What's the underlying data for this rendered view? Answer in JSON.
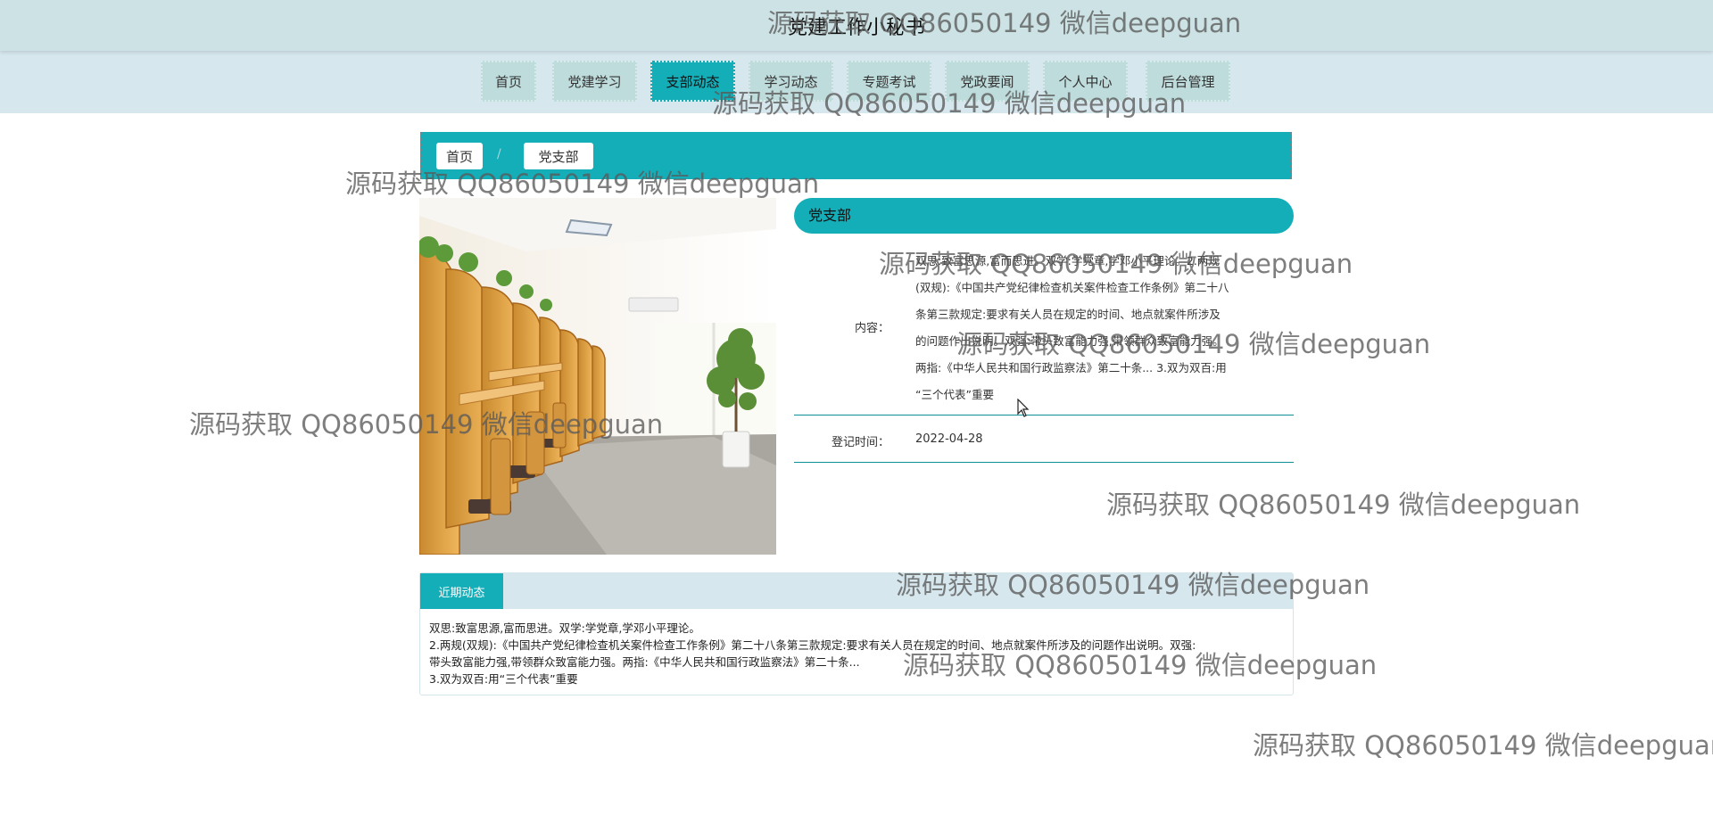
{
  "header": {
    "title": "党建工作小秘书"
  },
  "nav": {
    "items": [
      {
        "label": "首页"
      },
      {
        "label": "党建学习"
      },
      {
        "label": "支部动态",
        "active": true
      },
      {
        "label": "学习动态"
      },
      {
        "label": "专题考试"
      },
      {
        "label": "党政要闻"
      },
      {
        "label": "个人中心"
      },
      {
        "label": "后台管理"
      }
    ]
  },
  "breadcrumb": {
    "home": "首页",
    "separator": "/",
    "current": "党支部"
  },
  "detail": {
    "title": "党支部",
    "content_label": "内容：",
    "content_lines": [
      "双思:致富思源,富而思进。双学:学党章,学邓小平理论。2.两规",
      "(双规):《中国共产党纪律检查机关案件检查工作条例》第二十八",
      "条第三款规定:要求有关人员在规定的时间、地点就案件所涉及",
      "的问题作出说明。双强:带头致富能力强,带领群众致富能力强。",
      "两指:《中华人民共和国行政监察法》第二十条... 3.双为双百:用",
      "“三个代表”重要"
    ],
    "time_label": "登记时间：",
    "time_value": "2022-04-28"
  },
  "recent": {
    "tab": "近期动态",
    "lines": [
      "双思:致富思源,富而思进。双学:学党章,学邓小平理论。",
      "2.两规(双规):《中国共产党纪律检查机关案件检查工作条例》第二十八条第三款规定:要求有关人员在规定的时间、地点就案件所涉及的问题作出说明。双强:",
      "带头致富能力强,带领群众致富能力强。两指:《中华人民共和国行政监察法》第二十条...",
      "3.双为双百:用“三个代表”重要"
    ]
  },
  "watermark": {
    "text": "源码获取 QQ86050149 微信deepguan"
  },
  "colors": {
    "accent": "#14aeb9",
    "topbar": "#cde2e4",
    "navbar": "#d7e7ee"
  }
}
